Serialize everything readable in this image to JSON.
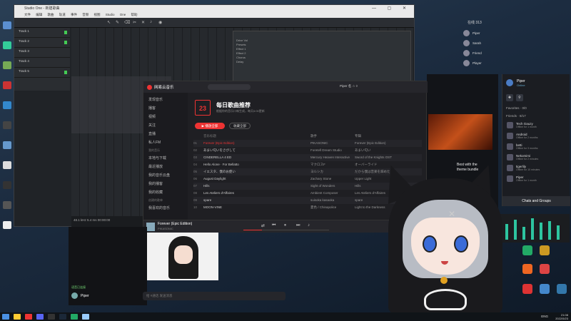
{
  "daw": {
    "title": "Studio One - 新建歌曲",
    "menu": "文件  编辑  歌曲  轨道  事件  音频  视图  Studio One  帮助",
    "tracks": [
      "Track 1",
      "Track 2",
      "Track 3",
      "Track 4",
      "Track 5"
    ],
    "status": "48.1 kHz   5.4 ms   00:00:00",
    "dialog_items": [
      "Drive Vol",
      "Presets",
      "Effect 1",
      "Effect 2",
      "Chorus",
      "Delay"
    ]
  },
  "social": {
    "title": "在线 313",
    "rows": [
      {
        "name": "Piper"
      },
      {
        "name": "Sarah"
      },
      {
        "name": "Friend"
      },
      {
        "name": "Player"
      }
    ]
  },
  "friends": {
    "me_name": "Piper",
    "me_status": "Online",
    "favorites_label": "Favorites · 0/0",
    "friends_label": "Friends · 8/17",
    "list": [
      {
        "name": "Tech Gauzy",
        "status": "Offline for 1 month"
      },
      {
        "name": "Android",
        "status": "Offline for 2 months"
      },
      {
        "name": "betti",
        "status": "Offline for 3 months"
      },
      {
        "name": "Nekomimi",
        "status": "Offline for 2 minutes"
      },
      {
        "name": "tigerlily",
        "status": "Offline for 10 minutes"
      },
      {
        "name": "Piper",
        "status": "Offline for 1 month"
      }
    ],
    "chats_label": "Chats and Groups"
  },
  "game": {
    "text_line1": "Best with the",
    "text_line2": "theme bundle"
  },
  "music": {
    "app_name": "网易云音乐",
    "user": "Piper 名 ☆ ◊",
    "sidebar": [
      "发现音乐",
      "播客",
      "视频",
      "关注",
      "直播",
      "私人FM"
    ],
    "sidebar_section": "我的音乐",
    "sidebar_my": [
      "本地与下载",
      "最近播放",
      "我的音乐云盘",
      "我的播客",
      "我的收藏"
    ],
    "sidebar_section2": "创建的歌单",
    "sidebar_my2": [
      "我喜欢的音乐"
    ],
    "cal_day": "23",
    "heading": "每日歌曲推荐",
    "subheading": "根据你的音乐口味生成，每天6:00更新",
    "play_all": "▶ 播放全部",
    "collect_all": "收藏全部",
    "columns": {
      "title": "音乐标题",
      "artist": "歌手",
      "album": "专辑"
    },
    "songs": [
      {
        "idx": "01",
        "title": "Forever (Epic Edition)",
        "artist": "PIKASONIC",
        "album": "Forever (Epic Edition)",
        "playing": true
      },
      {
        "idx": "02",
        "title": "あまい匂いをさがして",
        "artist": "Foretell Dream Studio",
        "album": "あまい匂い",
        "playing": false
      },
      {
        "idx": "03",
        "title": "CINDERELLA 4 ED",
        "artist": "Mercury Heaven Interactive",
        "album": "Sword of the Knights OST",
        "playing": false
      },
      {
        "idx": "04",
        "title": "Hello Alone · For Bellatto",
        "artist": "マクロスF",
        "album": "オーバーライド",
        "playing": false
      },
      {
        "idx": "05",
        "title": "イエスタ、僕のお使い",
        "artist": "ヨルシカ",
        "album": "だから僕は音楽を辞めた",
        "playing": false
      },
      {
        "idx": "06",
        "title": "August Daylight",
        "artist": "Zachary Stone",
        "album": "Upper Light",
        "playing": false
      },
      {
        "idx": "07",
        "title": "Hills",
        "artist": "Sight of Wonders",
        "album": "Hills",
        "playing": false
      },
      {
        "idx": "08",
        "title": "Les Ateliers d'Affaires",
        "artist": "Ambient Composer",
        "album": "Les Ateliers d'Affaires",
        "playing": false
      },
      {
        "idx": "09",
        "title": "spare",
        "artist": "suisoka kasaoka",
        "album": "spare",
        "playing": false
      },
      {
        "idx": "10",
        "title": "MOON-VINE",
        "artist": "夏色 / Chinapolice",
        "album": "Light to the Darkness",
        "playing": false
      }
    ],
    "now_playing_title": "Forever (Epic Edition)",
    "now_playing_artist": "PIKASONIC",
    "progress": 0.22
  },
  "call": {
    "voice_label": "语音已连接",
    "user": "Piper",
    "input_placeholder": "给 #通话 发送消息"
  },
  "taskbar": {
    "lang": "ENG",
    "time": "21:08",
    "date": "2022/5/23"
  }
}
